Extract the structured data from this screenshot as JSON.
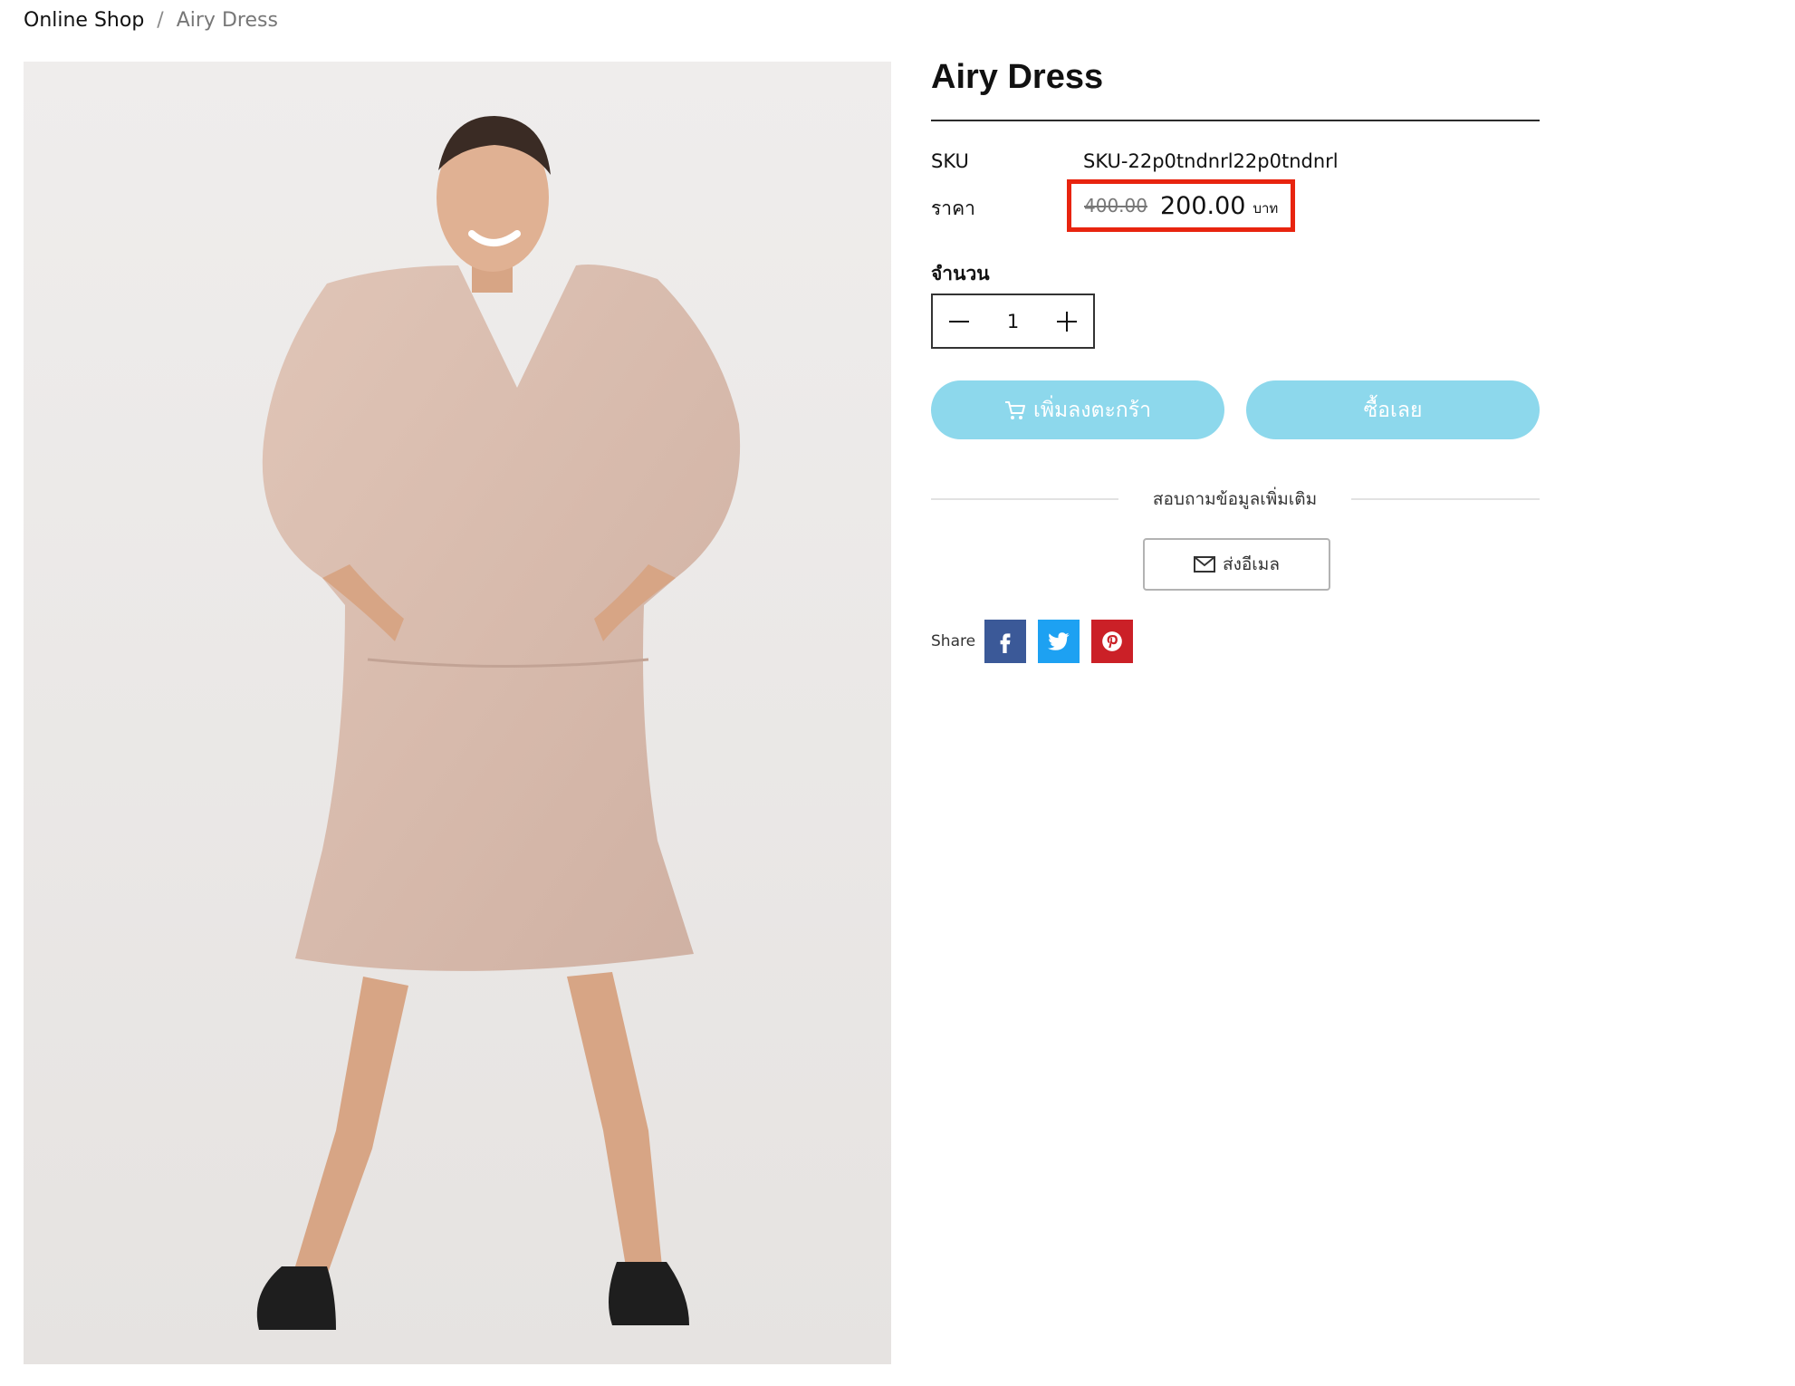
{
  "breadcrumb": {
    "home": "Online Shop",
    "separator": "/",
    "current": "Airy Dress"
  },
  "product": {
    "title": "Airy Dress",
    "image_icon": "product-photo",
    "sku_label": "SKU",
    "sku_value": "SKU-22p0tndnrl22p0tndnrl",
    "price_label": "ราคา",
    "price_old": "400.00",
    "price_new": "200.00",
    "price_unit": "บาท",
    "highlight_color": "#e8240f"
  },
  "quantity": {
    "label": "จำนวน",
    "value": "1"
  },
  "actions": {
    "add_to_cart": "เพิ่มลงตะกร้า",
    "buy_now": "ซื้อเลย",
    "button_color": "#8dd8ec"
  },
  "inquiry": {
    "title": "สอบถามข้อมูลเพิ่มเติม",
    "email_button": "ส่งอีเมล"
  },
  "share": {
    "label": "Share",
    "networks": [
      {
        "name": "facebook",
        "icon": "facebook-icon",
        "color": "#3b5998"
      },
      {
        "name": "twitter",
        "icon": "twitter-icon",
        "color": "#1da1f2"
      },
      {
        "name": "pinterest",
        "icon": "pinterest-icon",
        "color": "#cb2027"
      }
    ]
  }
}
